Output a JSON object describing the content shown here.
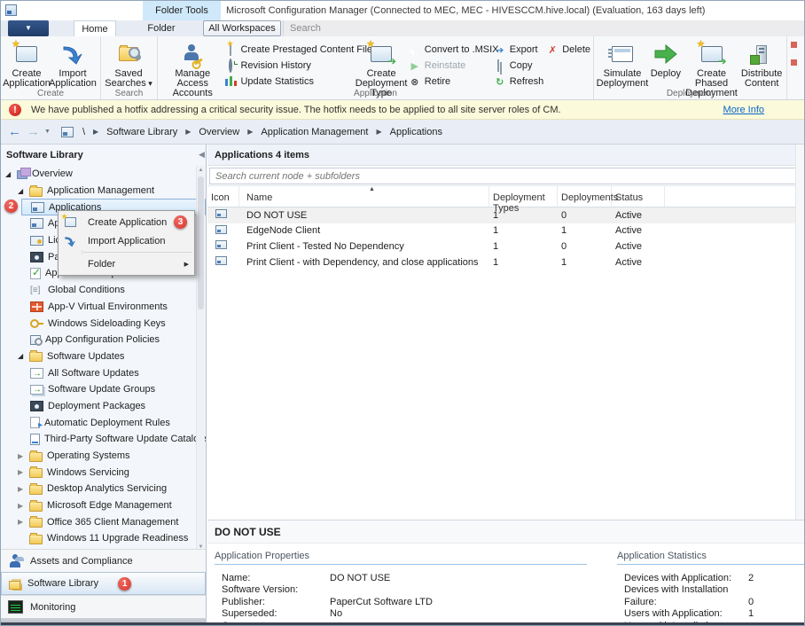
{
  "window": {
    "folder_tools": "Folder Tools",
    "title": "Microsoft Configuration Manager (Connected to MEC, MEC - HIVESCCM.hive.local) (Evaluation, 163 days left)"
  },
  "tabs": {
    "home": "Home",
    "folder": "Folder",
    "all_workspaces": "All Workspaces",
    "search": "Search"
  },
  "ribbon": {
    "create_application": "Create Application",
    "import_application": "Import Application",
    "saved_searches": "Saved Searches",
    "manage_access_accounts": "Manage Access Accounts",
    "create_prestaged": "Create Prestaged Content File",
    "revision_history": "Revision History",
    "update_statistics": "Update Statistics",
    "create_deployment_type": "Create Deployment Type",
    "convert_msix": "Convert to .MSIX",
    "reinstate": "Reinstate",
    "retire": "Retire",
    "export": "Export",
    "copy": "Copy",
    "refresh": "Refresh",
    "delete": "Delete",
    "simulate_deployment": "Simulate Deployment",
    "deploy": "Deploy",
    "create_phased": "Create Phased Deployment",
    "distribute_content": "Distribute Content",
    "group_create": "Create",
    "group_search": "Search",
    "group_application": "Application",
    "group_deployment": "Deployment"
  },
  "notification": {
    "message": "We have published a hotfix addressing a critical security issue. The hotfix needs to be applied to all site server roles of CM.",
    "link": "More Info"
  },
  "breadcrumb": {
    "root": "\\",
    "items": [
      "Software Library",
      "Overview",
      "Application Management",
      "Applications"
    ]
  },
  "sidebar": {
    "title": "Software Library",
    "tree": [
      {
        "label": "Overview"
      },
      {
        "label": "Application Management"
      },
      {
        "label": "Applications"
      },
      {
        "label": "App"
      },
      {
        "label": "Lice"
      },
      {
        "label": "Pack"
      },
      {
        "label": "Application Requests"
      },
      {
        "label": "Global Conditions"
      },
      {
        "label": "App-V Virtual Environments"
      },
      {
        "label": "Windows Sideloading Keys"
      },
      {
        "label": "App Configuration Policies"
      },
      {
        "label": "Software Updates"
      },
      {
        "label": "All Software Updates"
      },
      {
        "label": "Software Update Groups"
      },
      {
        "label": "Deployment Packages"
      },
      {
        "label": "Automatic Deployment Rules"
      },
      {
        "label": "Third-Party Software Update Catalogs"
      },
      {
        "label": "Operating Systems"
      },
      {
        "label": "Windows Servicing"
      },
      {
        "label": "Desktop Analytics Servicing"
      },
      {
        "label": "Microsoft Edge Management"
      },
      {
        "label": "Office 365 Client Management"
      },
      {
        "label": "Windows 11 Upgrade Readiness"
      }
    ],
    "workspaces": [
      {
        "label": "Assets and Compliance"
      },
      {
        "label": "Software Library",
        "badge": "1"
      },
      {
        "label": "Monitoring"
      }
    ]
  },
  "context_menu": {
    "items": [
      {
        "label": "Create Application",
        "badge": "3"
      },
      {
        "label": "Import Application"
      },
      {
        "label": "Folder"
      }
    ]
  },
  "main": {
    "header": "Applications 4 items",
    "search_placeholder": "Search current node + subfolders",
    "table": {
      "columns": [
        "Icon",
        "Name",
        "Deployment Types",
        "Deployments",
        "Status"
      ],
      "rows": [
        {
          "name": "DO NOT USE",
          "deployment_types": "1",
          "deployments": "0",
          "status": "Active"
        },
        {
          "name": "EdgeNode Client",
          "deployment_types": "1",
          "deployments": "1",
          "status": "Active"
        },
        {
          "name": "Print Client - Tested No Dependency",
          "deployment_types": "1",
          "deployments": "0",
          "status": "Active"
        },
        {
          "name": "Print Client - with Dependency, and close applications",
          "deployment_types": "1",
          "deployments": "1",
          "status": "Active"
        }
      ]
    }
  },
  "details": {
    "title": "DO NOT USE",
    "properties": {
      "heading": "Application Properties",
      "rows": [
        {
          "label": "Name:",
          "value": "DO NOT USE"
        },
        {
          "label": "Software Version:",
          "value": ""
        },
        {
          "label": "Publisher:",
          "value": "PaperCut Software LTD"
        },
        {
          "label": "Superseded:",
          "value": "No"
        },
        {
          "label": "Comments:",
          "value": ""
        }
      ]
    },
    "statistics": {
      "heading": "Application Statistics",
      "rows": [
        {
          "label": "Devices with Application:",
          "value": "2"
        },
        {
          "label": "Devices with Installation",
          "value": ""
        },
        {
          "label": "Failure:",
          "value": "0"
        },
        {
          "label": "Users with Application:",
          "value": "1"
        },
        {
          "label": "Users with Installation",
          "value": ""
        }
      ]
    }
  },
  "callouts": {
    "one": "1",
    "two": "2",
    "three": "3"
  },
  "icons": {
    "app-icon": "window-glyph",
    "folder-icon": "yellow-folder",
    "overview-icon": "stacked-boxes",
    "import-arrow-icon": "blue-curved-arrow",
    "deploy-icon": "green-arrow",
    "delete-icon": "red-x",
    "retire-icon": "circle-x",
    "refresh-icon": "circular-arrow",
    "export-icon": "blue-arrow",
    "notification-icon": "red-exclamation-circle",
    "sort-ascending-icon": "up-triangle",
    "tree-expanded-icon": "black-corner-triangle",
    "tree-collapsed-icon": "gray-right-triangle"
  },
  "colors": {
    "accent_blue": "#2b4d80",
    "selection_blue": "#d3e9fb",
    "badge_red": "#d8362e",
    "notification_yellow": "#fbfadb",
    "link_blue": "#0a64c8",
    "folder_yellow": "#f2ca55",
    "green": "#3fae49"
  }
}
